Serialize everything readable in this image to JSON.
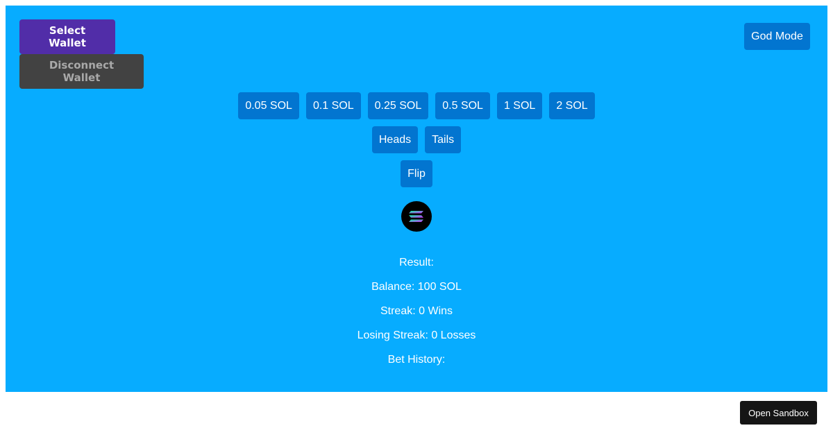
{
  "wallet": {
    "select_label": "Select Wallet",
    "disconnect_label": "Disconnect Wallet"
  },
  "god_mode_label": "God Mode",
  "bet_amounts": [
    "0.05 SOL",
    "0.1 SOL",
    "0.25 SOL",
    "0.5 SOL",
    "1 SOL",
    "2 SOL"
  ],
  "sides": [
    "Heads",
    "Tails"
  ],
  "flip_label": "Flip",
  "coin_icon": "solana-logo-icon",
  "stats": {
    "result": "Result:",
    "balance": "Balance: 100 SOL",
    "streak": "Streak: 0 Wins",
    "losing_streak": "Losing Streak: 0 Losses",
    "bet_history": "Bet History:"
  },
  "sandbox_label": "Open Sandbox",
  "colors": {
    "app_background": "#07acff",
    "button": "#0275d0",
    "select_wallet": "#512da8",
    "disconnect_wallet": "#424242"
  }
}
